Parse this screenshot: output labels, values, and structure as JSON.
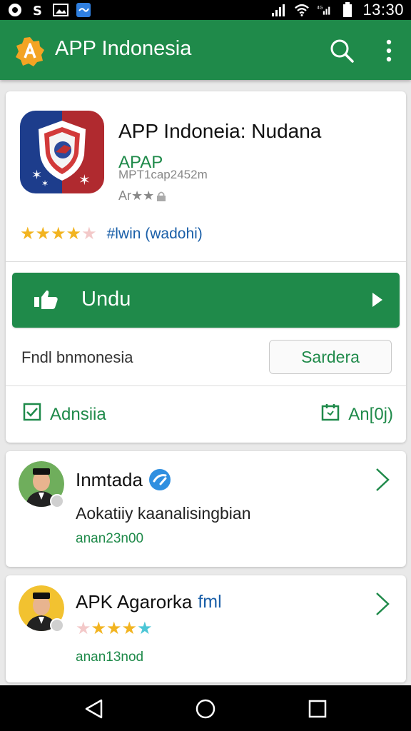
{
  "status_bar": {
    "time": "13:30",
    "icons": [
      "sync-icon",
      "s-notification-icon",
      "image-icon",
      "message-icon",
      "signal-icon",
      "wifi-icon",
      "lte-signal-icon",
      "battery-icon"
    ]
  },
  "app_bar": {
    "title": "APP Indonesia",
    "color": "#1f8a4a"
  },
  "app": {
    "name": "APP Indoneia: Nudana",
    "developer": "APAP",
    "meta": "MPT1cap2452m",
    "rating_prefix": "Ar★★",
    "stars_label": "#lwin (wadohi)",
    "rating": 4.5,
    "install_label": "Undu",
    "sub_label": "Fndl bnmonesia",
    "sub_button": "Sardera",
    "action_left": "Adnsiia",
    "action_right": "An[0j)"
  },
  "reviews": [
    {
      "name": "Inmtada",
      "text": "Aokatiiy kaanalisingbian",
      "date": "anan23n00"
    },
    {
      "name": "APK Agarorka",
      "tag": "fml",
      "rating": 4,
      "date": "anan13nod"
    }
  ],
  "colors": {
    "accent": "#1f8a4a",
    "link": "#1a5fa8",
    "star": "#f2b421"
  }
}
